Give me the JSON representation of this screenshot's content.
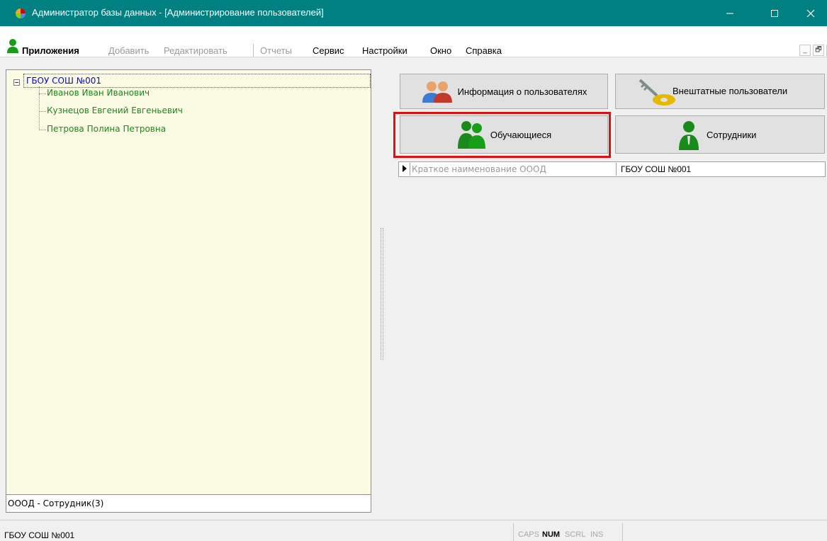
{
  "window": {
    "title": "Администратор базы данных - [Администрирование пользователей]",
    "titlebar_color": "#008080"
  },
  "menu": {
    "items": [
      {
        "label": "Приложения",
        "enabled": true
      },
      {
        "label": "Добавить",
        "enabled": false
      },
      {
        "label": "Редактировать",
        "enabled": false
      },
      {
        "label": "Отчеты",
        "enabled": false
      },
      {
        "label": "Сервис",
        "enabled": true
      },
      {
        "label": "Настройки",
        "enabled": true
      },
      {
        "label": "Окно",
        "enabled": true
      },
      {
        "label": "Справка",
        "enabled": true
      }
    ],
    "mdi_controls": [
      "_",
      "🗗",
      "×"
    ]
  },
  "tree": {
    "root": {
      "label": "ГБОУ СОШ №001",
      "expanded": true
    },
    "children": [
      "Иванов Иван Иванович",
      "Кузнецов Евгений Евгеньевич",
      "Петрова Полина Петровна"
    ],
    "status": "ОООД - Сотрудник(3)",
    "root_color": "#0000ff",
    "child_color": "#1a8a1a",
    "background": "#fbfbe3"
  },
  "buttons": {
    "info_users": "Информация о пользователях",
    "external_users": "Внештатные пользователи",
    "students": "Обучающиеся",
    "staff": "Сотрудники",
    "highlighted": "students",
    "highlight_color": "#e01010"
  },
  "property_grid": {
    "rows": [
      {
        "name": "Краткое наименование ОООД",
        "value": "ГБОУ СОШ №001"
      }
    ]
  },
  "statusbar": {
    "text": "ГБОУ СОШ №001",
    "indicators": [
      {
        "label": "CAPS",
        "on": false
      },
      {
        "label": "NUM",
        "on": true
      },
      {
        "label": "SCRL",
        "on": false
      },
      {
        "label": "INS",
        "on": false
      }
    ]
  }
}
